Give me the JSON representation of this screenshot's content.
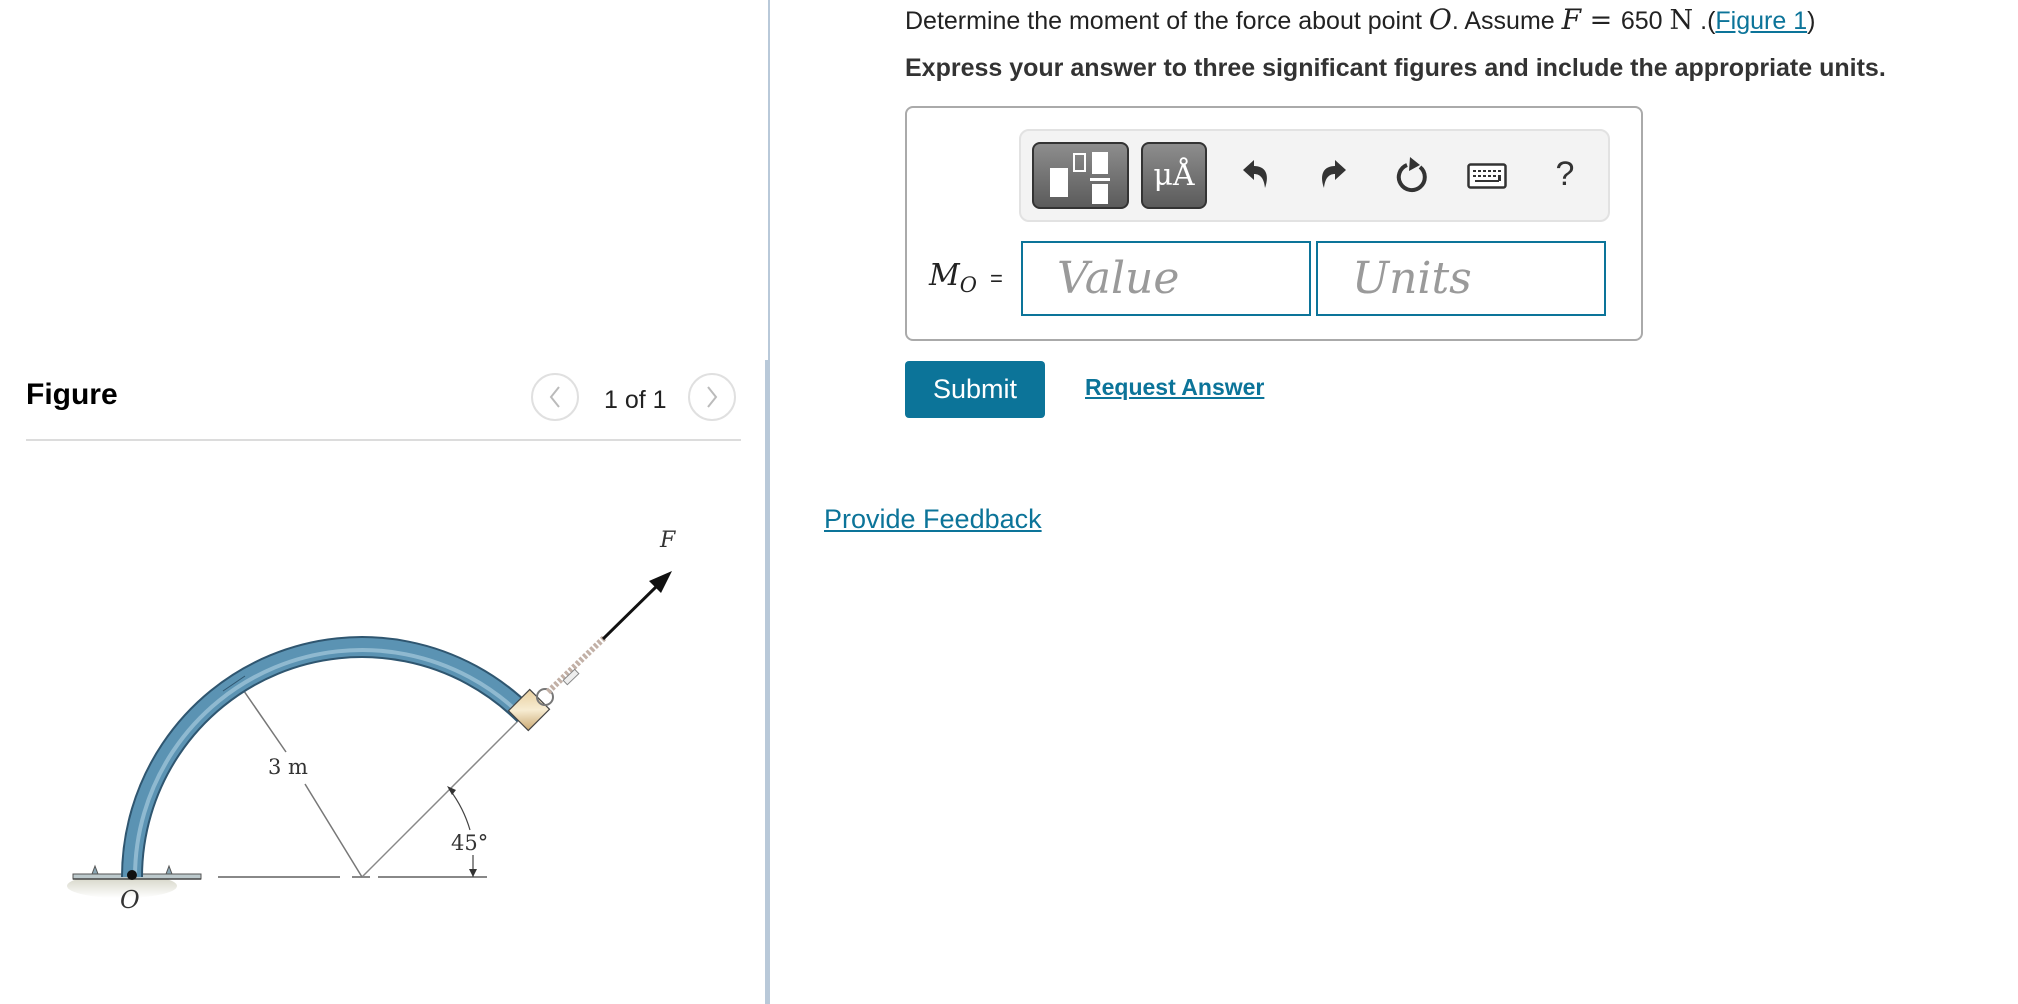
{
  "question": {
    "prefix": "Determine the moment of the force about point ",
    "point": "O",
    "assume": ". Assume ",
    "force_var": "F",
    "equals": " = ",
    "force_value": "650",
    "force_unit": "N",
    "link_prefix": " .(",
    "figure_link": "Figure 1",
    "link_suffix": ")"
  },
  "instruction": "Express your answer to three significant figures and include the appropriate units.",
  "answer": {
    "label_main": "M",
    "label_sub": "O",
    "equals": "=",
    "value_placeholder": "Value",
    "units_placeholder": "Units",
    "toolbar": {
      "templates_icon": "fraction-templates-icon",
      "units_label": "μÅ",
      "undo_icon": "undo-icon",
      "redo_icon": "redo-icon",
      "reset_icon": "reset-icon",
      "keyboard_icon": "keyboard-icon",
      "help_label": "?"
    }
  },
  "buttons": {
    "submit": "Submit",
    "request_answer": "Request Answer",
    "provide_feedback": "Provide Feedback"
  },
  "figure_panel": {
    "heading": "Figure",
    "page_indicator": "1 of 1",
    "prev_icon": "chevron-left-icon",
    "next_icon": "chevron-right-icon",
    "diagram": {
      "force_label": "F",
      "radius_label": "3 m",
      "angle_label": "45°",
      "point_label": "O"
    }
  },
  "colors": {
    "accent": "#0c7499",
    "divider": "#b9c9d9",
    "pipe": "#5b93b3"
  }
}
